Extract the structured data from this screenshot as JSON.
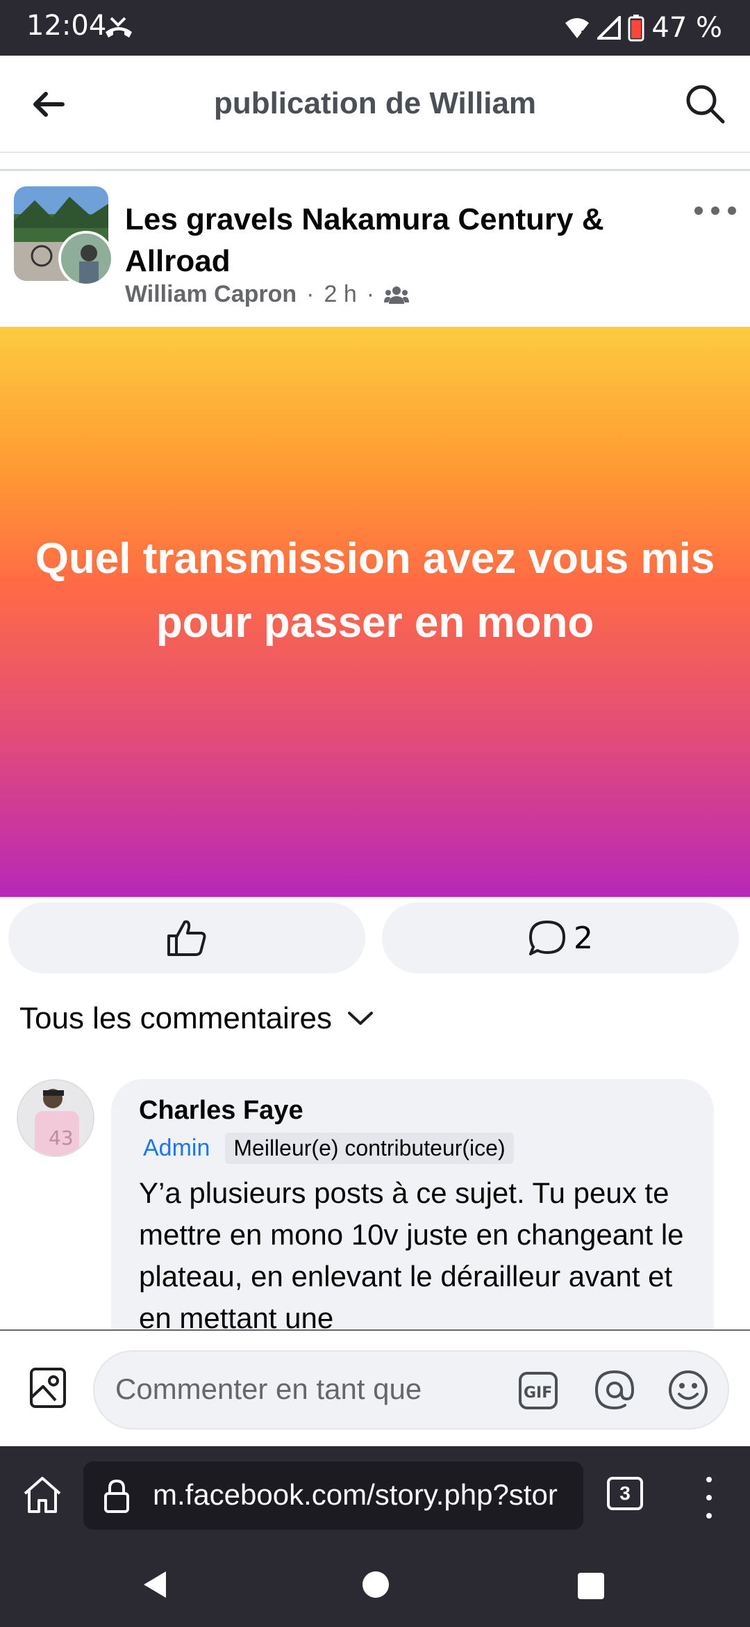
{
  "status_bar": {
    "time": "12:04",
    "battery_text": "47 %",
    "icons": [
      "missed-call-icon",
      "wifi-icon",
      "signal-icon",
      "battery-icon"
    ]
  },
  "header": {
    "title": "publication de William",
    "back_icon": "arrow-left-icon",
    "search_icon": "search-icon"
  },
  "post": {
    "group_name": "Les gravels Nakamura Century & Allroad",
    "author": "William Capron",
    "time": "2 h",
    "privacy_icon": "group-icon",
    "text": "Quel transmission avez vous mis pour passer en mono",
    "background_colors": [
      "#fdcb3f",
      "#ff6b45",
      "#b827b8"
    ],
    "comment_count": "2"
  },
  "comments_section": {
    "sort_label": "Tous les commentaires"
  },
  "comment": {
    "author": "Charles Faye",
    "badge_admin": "Admin",
    "badge_top": "Meilleur(e) contributeur(ice)",
    "text": "Y’a plusieurs posts à ce sujet. Tu peux te mettre en mono 10v juste en changeant le plateau, en enlevant le dérailleur avant et en mettant une"
  },
  "composer": {
    "placeholder": "Commenter en tant que"
  },
  "browser": {
    "url": "m.facebook.com/story.php?stor",
    "tab_count": "3"
  },
  "colors": {
    "status_bar_bg": "#2b2a33",
    "link_blue": "#1877f2",
    "muted_text": "#65676b",
    "button_bg": "#f0f2f5"
  }
}
